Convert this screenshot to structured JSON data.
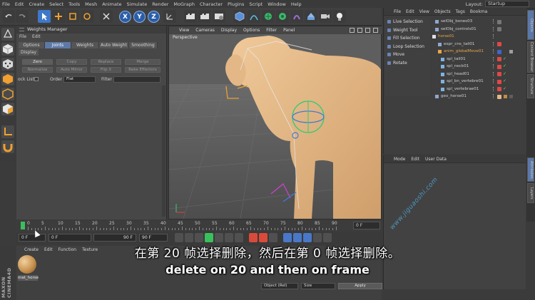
{
  "menubar": {
    "items": [
      "File",
      "Edit",
      "Create",
      "Select",
      "Tools",
      "Mesh",
      "Animate",
      "Simulate",
      "Render",
      "MoGraph",
      "Character",
      "Plugins",
      "Script",
      "Window",
      "Help"
    ],
    "layout_label": "Layout:",
    "layout_value": "Startup"
  },
  "toolbar": {
    "axis_x": "X",
    "axis_y": "Y",
    "axis_z": "Z"
  },
  "weights_manager": {
    "title": "Weights Manager",
    "file": "File",
    "edit": "Edit",
    "tabs": [
      "Options",
      "Joints",
      "Weights",
      "Auto Weight",
      "Smoothing"
    ],
    "display_tab": "Display",
    "row1": [
      "Zero",
      "Copy",
      "Replace",
      "Merge"
    ],
    "row2": [
      "Normalize",
      "Auto Mirror",
      "Flip X",
      "Bake Effectors"
    ],
    "lock_list": "ock List",
    "order_label": "Order",
    "order_value": "Flat",
    "filter_label": "Filter"
  },
  "viewport": {
    "menu": [
      "View",
      "Cameras",
      "Display",
      "Options",
      "Filter",
      "Panel"
    ],
    "label": "Perspective"
  },
  "object_manager": {
    "menu": [
      "File",
      "Edit",
      "View",
      "Objects",
      "Tags",
      "Bookma"
    ],
    "context_menu": [
      "Live Selection",
      "Weight Tool",
      "Fill Selection",
      "Loop Selection",
      "Move",
      "Rotate"
    ],
    "objects": [
      {
        "name": "selObj_bones03",
        "color": "#bdbdbd"
      },
      {
        "name": "selObj_controls01",
        "color": "#bdbdbd"
      },
      {
        "name": "horse01",
        "color": "#e8a64a"
      },
      {
        "name": "expr_cns_tail01",
        "color": "#bdbdbd"
      },
      {
        "name": "anim_globalMove01",
        "color": "#e8a64a"
      },
      {
        "name": "spl_tail01",
        "color": "#bdbdbd"
      },
      {
        "name": "spl_neck01",
        "color": "#bdbdbd"
      },
      {
        "name": "spl_head01",
        "color": "#bdbdbd"
      },
      {
        "name": "spl_bn_vertebre01",
        "color": "#bdbdbd"
      },
      {
        "name": "spl_vertebrae01",
        "color": "#bdbdbd"
      },
      {
        "name": "geo_horse01",
        "color": "#bdbdbd"
      }
    ]
  },
  "attribute_manager": {
    "menu": [
      "Mode",
      "Edit",
      "User Data"
    ]
  },
  "right_tabs": [
    "Objects",
    "Content Browser",
    "Structure",
    "Attributes",
    "Layers"
  ],
  "timeline": {
    "ticks": [
      "0",
      "5",
      "10",
      "15",
      "20",
      "25",
      "30",
      "35",
      "40",
      "45",
      "50",
      "55",
      "60",
      "65",
      "70",
      "75",
      "80",
      "85",
      "90"
    ],
    "end_field": "0 F"
  },
  "transport": {
    "start": "0 F",
    "current": "0 F",
    "end_a": "90 F",
    "end_b": "90 F"
  },
  "material_manager": {
    "menu": [
      "Create",
      "Edit",
      "Function",
      "Texture"
    ],
    "material_name": "mat_horse",
    "object_rel": "Object (Rel)",
    "size": "Size",
    "apply": "Apply"
  },
  "logo": {
    "text": "MAXON CINEMA4D"
  },
  "subtitles": {
    "chinese": "在第 20 帧选择删除，然后在第 0 帧选择删除。",
    "english": "delete on 20 and then on frame"
  },
  "watermark": "www.jiguaoshi.com",
  "colors": {
    "accent_blue": "#3e78c8",
    "horse": "#e3b886",
    "selection_orange": "#e8a64a"
  }
}
